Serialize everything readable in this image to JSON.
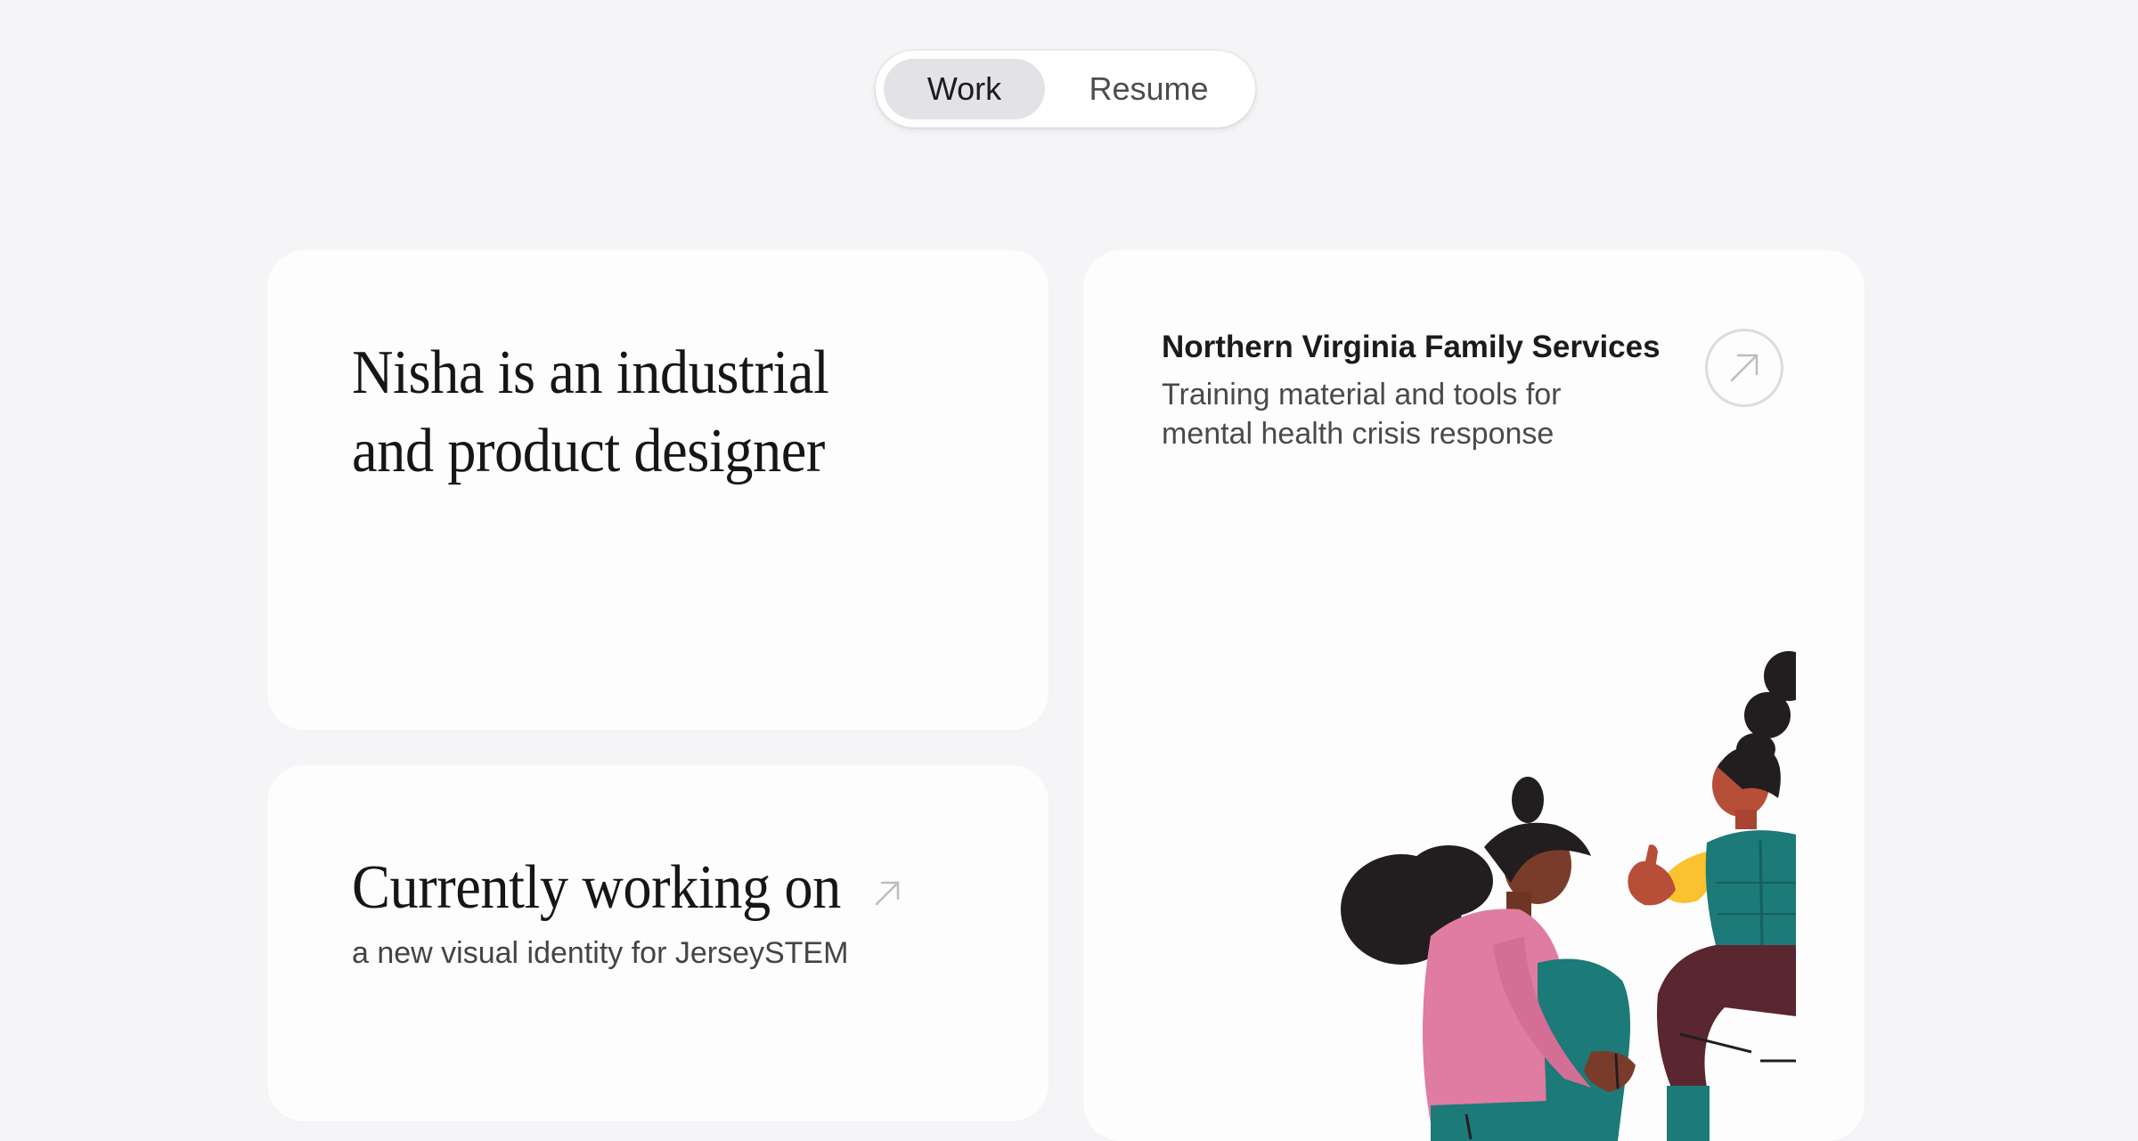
{
  "toggle": {
    "work_label": "Work",
    "resume_label": "Resume",
    "selected": "Work"
  },
  "intro": {
    "line1": "Nisha is an industrial",
    "line2": "and product designer"
  },
  "current": {
    "heading": "Currently working on",
    "subtitle": "a new visual identity for JerseySTEM"
  },
  "project": {
    "title": "Northern Virginia Family Services",
    "desc_line1": "Training material and tools for",
    "desc_line2": "mental health crisis response"
  },
  "icons": {
    "arrow": "arrow-up-right-icon"
  },
  "colors": {
    "background": "#f5f5f7",
    "card": "#fdfdfd",
    "toggle_active": "#e3e3e7",
    "figure_pink": "#e07ba1",
    "figure_teal": "#1c7a78",
    "figure_yellow": "#f9c22e",
    "figure_maroon": "#5a2630"
  }
}
